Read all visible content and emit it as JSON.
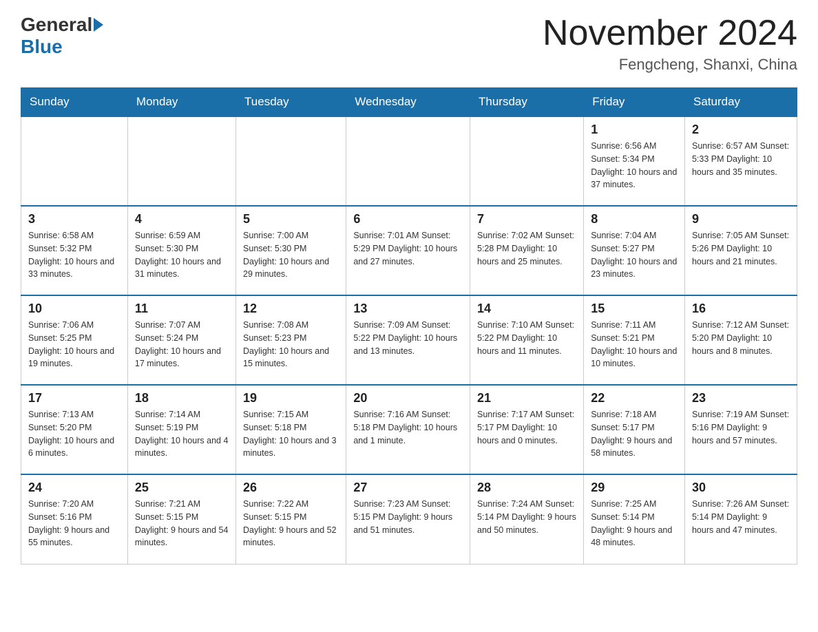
{
  "header": {
    "logo": {
      "part1": "General",
      "part2": "Blue"
    },
    "title": "November 2024",
    "location": "Fengcheng, Shanxi, China"
  },
  "weekdays": [
    "Sunday",
    "Monday",
    "Tuesday",
    "Wednesday",
    "Thursday",
    "Friday",
    "Saturday"
  ],
  "weeks": [
    [
      {
        "day": "",
        "info": ""
      },
      {
        "day": "",
        "info": ""
      },
      {
        "day": "",
        "info": ""
      },
      {
        "day": "",
        "info": ""
      },
      {
        "day": "",
        "info": ""
      },
      {
        "day": "1",
        "info": "Sunrise: 6:56 AM\nSunset: 5:34 PM\nDaylight: 10 hours\nand 37 minutes."
      },
      {
        "day": "2",
        "info": "Sunrise: 6:57 AM\nSunset: 5:33 PM\nDaylight: 10 hours\nand 35 minutes."
      }
    ],
    [
      {
        "day": "3",
        "info": "Sunrise: 6:58 AM\nSunset: 5:32 PM\nDaylight: 10 hours\nand 33 minutes."
      },
      {
        "day": "4",
        "info": "Sunrise: 6:59 AM\nSunset: 5:30 PM\nDaylight: 10 hours\nand 31 minutes."
      },
      {
        "day": "5",
        "info": "Sunrise: 7:00 AM\nSunset: 5:30 PM\nDaylight: 10 hours\nand 29 minutes."
      },
      {
        "day": "6",
        "info": "Sunrise: 7:01 AM\nSunset: 5:29 PM\nDaylight: 10 hours\nand 27 minutes."
      },
      {
        "day": "7",
        "info": "Sunrise: 7:02 AM\nSunset: 5:28 PM\nDaylight: 10 hours\nand 25 minutes."
      },
      {
        "day": "8",
        "info": "Sunrise: 7:04 AM\nSunset: 5:27 PM\nDaylight: 10 hours\nand 23 minutes."
      },
      {
        "day": "9",
        "info": "Sunrise: 7:05 AM\nSunset: 5:26 PM\nDaylight: 10 hours\nand 21 minutes."
      }
    ],
    [
      {
        "day": "10",
        "info": "Sunrise: 7:06 AM\nSunset: 5:25 PM\nDaylight: 10 hours\nand 19 minutes."
      },
      {
        "day": "11",
        "info": "Sunrise: 7:07 AM\nSunset: 5:24 PM\nDaylight: 10 hours\nand 17 minutes."
      },
      {
        "day": "12",
        "info": "Sunrise: 7:08 AM\nSunset: 5:23 PM\nDaylight: 10 hours\nand 15 minutes."
      },
      {
        "day": "13",
        "info": "Sunrise: 7:09 AM\nSunset: 5:22 PM\nDaylight: 10 hours\nand 13 minutes."
      },
      {
        "day": "14",
        "info": "Sunrise: 7:10 AM\nSunset: 5:22 PM\nDaylight: 10 hours\nand 11 minutes."
      },
      {
        "day": "15",
        "info": "Sunrise: 7:11 AM\nSunset: 5:21 PM\nDaylight: 10 hours\nand 10 minutes."
      },
      {
        "day": "16",
        "info": "Sunrise: 7:12 AM\nSunset: 5:20 PM\nDaylight: 10 hours\nand 8 minutes."
      }
    ],
    [
      {
        "day": "17",
        "info": "Sunrise: 7:13 AM\nSunset: 5:20 PM\nDaylight: 10 hours\nand 6 minutes."
      },
      {
        "day": "18",
        "info": "Sunrise: 7:14 AM\nSunset: 5:19 PM\nDaylight: 10 hours\nand 4 minutes."
      },
      {
        "day": "19",
        "info": "Sunrise: 7:15 AM\nSunset: 5:18 PM\nDaylight: 10 hours\nand 3 minutes."
      },
      {
        "day": "20",
        "info": "Sunrise: 7:16 AM\nSunset: 5:18 PM\nDaylight: 10 hours\nand 1 minute."
      },
      {
        "day": "21",
        "info": "Sunrise: 7:17 AM\nSunset: 5:17 PM\nDaylight: 10 hours\nand 0 minutes."
      },
      {
        "day": "22",
        "info": "Sunrise: 7:18 AM\nSunset: 5:17 PM\nDaylight: 9 hours\nand 58 minutes."
      },
      {
        "day": "23",
        "info": "Sunrise: 7:19 AM\nSunset: 5:16 PM\nDaylight: 9 hours\nand 57 minutes."
      }
    ],
    [
      {
        "day": "24",
        "info": "Sunrise: 7:20 AM\nSunset: 5:16 PM\nDaylight: 9 hours\nand 55 minutes."
      },
      {
        "day": "25",
        "info": "Sunrise: 7:21 AM\nSunset: 5:15 PM\nDaylight: 9 hours\nand 54 minutes."
      },
      {
        "day": "26",
        "info": "Sunrise: 7:22 AM\nSunset: 5:15 PM\nDaylight: 9 hours\nand 52 minutes."
      },
      {
        "day": "27",
        "info": "Sunrise: 7:23 AM\nSunset: 5:15 PM\nDaylight: 9 hours\nand 51 minutes."
      },
      {
        "day": "28",
        "info": "Sunrise: 7:24 AM\nSunset: 5:14 PM\nDaylight: 9 hours\nand 50 minutes."
      },
      {
        "day": "29",
        "info": "Sunrise: 7:25 AM\nSunset: 5:14 PM\nDaylight: 9 hours\nand 48 minutes."
      },
      {
        "day": "30",
        "info": "Sunrise: 7:26 AM\nSunset: 5:14 PM\nDaylight: 9 hours\nand 47 minutes."
      }
    ]
  ]
}
